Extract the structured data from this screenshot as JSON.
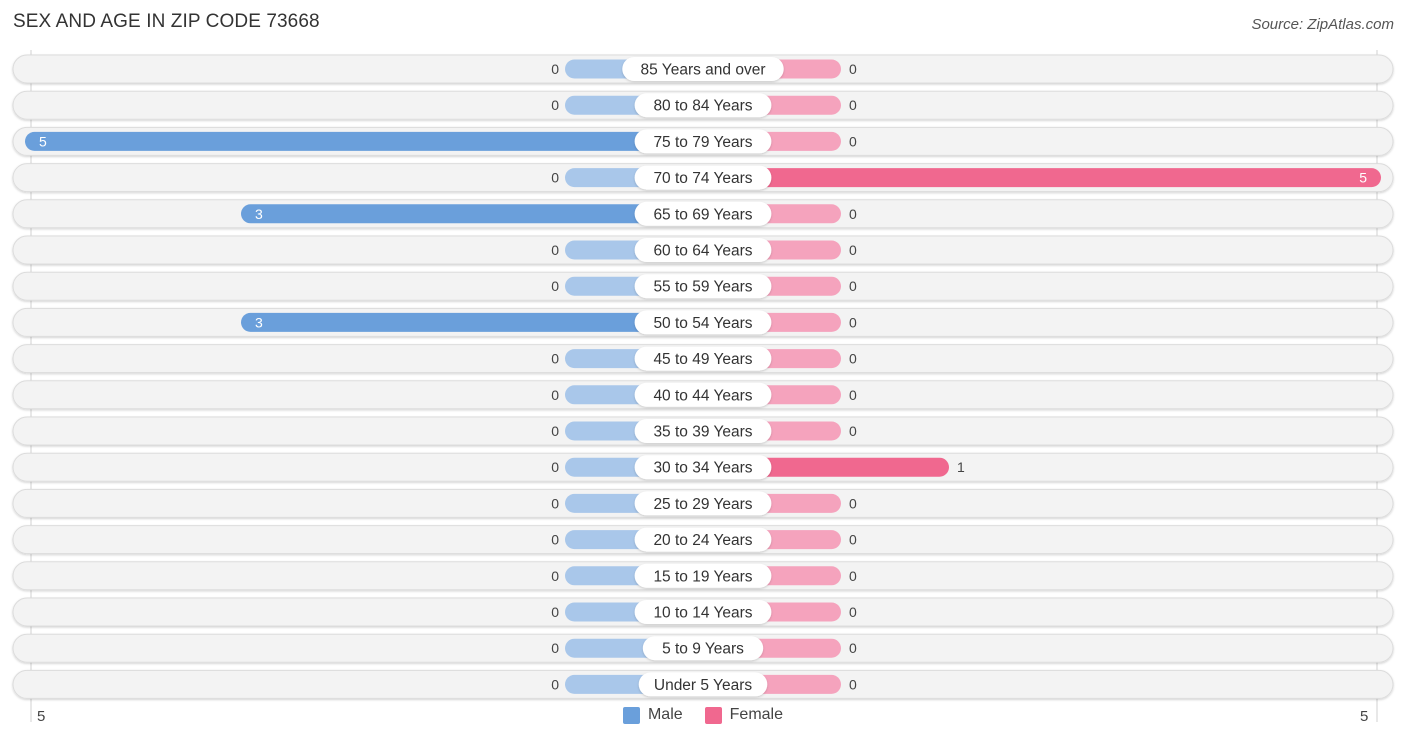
{
  "header": {
    "title": "SEX AND AGE IN ZIP CODE 73668",
    "source": "Source: ZipAtlas.com"
  },
  "colors": {
    "male": "#6a9fdb",
    "male_light": "#a9c7ea",
    "female": "#f0688f",
    "female_light": "#f5a3bd",
    "row_bg": "#f3f3f3"
  },
  "chart_data": {
    "type": "bar",
    "orientation": "horizontal-butterfly",
    "title": "SEX AND AGE IN ZIP CODE 73668",
    "categories": [
      "85 Years and over",
      "80 to 84 Years",
      "75 to 79 Years",
      "70 to 74 Years",
      "65 to 69 Years",
      "60 to 64 Years",
      "55 to 59 Years",
      "50 to 54 Years",
      "45 to 49 Years",
      "40 to 44 Years",
      "35 to 39 Years",
      "30 to 34 Years",
      "25 to 29 Years",
      "20 to 24 Years",
      "15 to 19 Years",
      "10 to 14 Years",
      "5 to 9 Years",
      "Under 5 Years"
    ],
    "series": [
      {
        "name": "Male",
        "values": [
          0,
          0,
          5,
          0,
          3,
          0,
          0,
          3,
          0,
          0,
          0,
          0,
          0,
          0,
          0,
          0,
          0,
          0
        ]
      },
      {
        "name": "Female",
        "values": [
          0,
          0,
          0,
          5,
          0,
          0,
          0,
          0,
          0,
          0,
          0,
          1,
          0,
          0,
          0,
          0,
          0,
          0
        ]
      }
    ],
    "axis": {
      "left_label": "5",
      "right_label": "5",
      "max": 5
    },
    "legend": {
      "position": "bottom-center",
      "entries": [
        "Male",
        "Female"
      ]
    }
  }
}
